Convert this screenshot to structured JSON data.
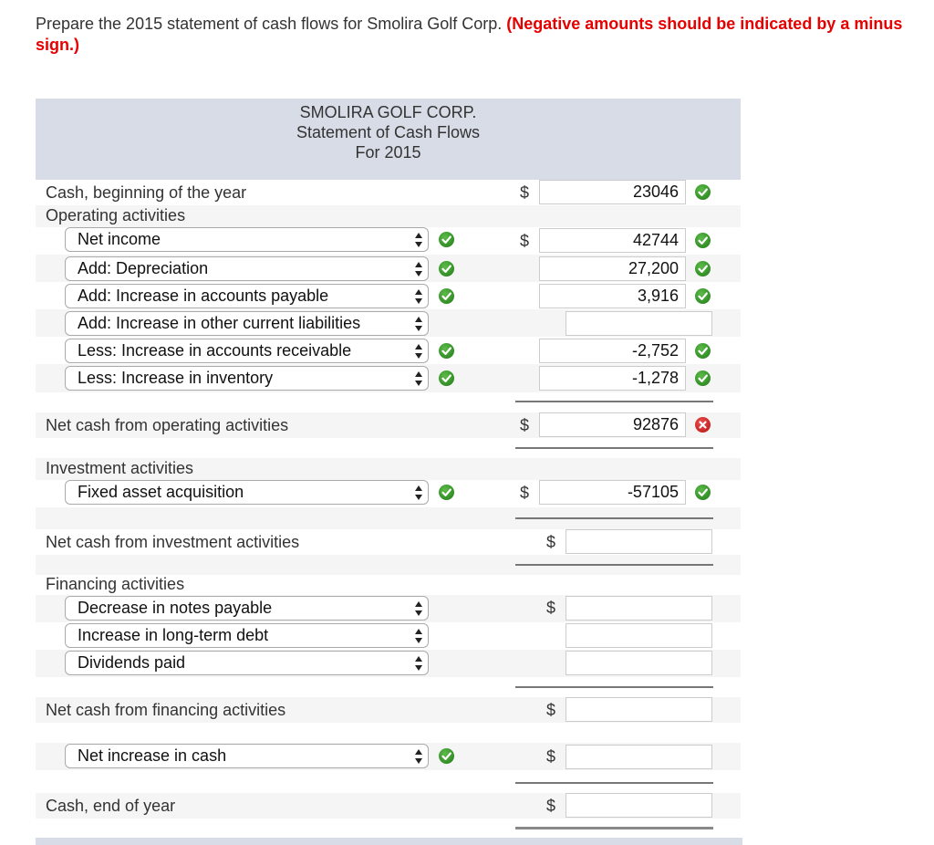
{
  "instructions": {
    "text": "Prepare the 2015 statement of cash flows for Smolira Golf Corp.",
    "note": "(Negative amounts should be indicated by a minus sign.)"
  },
  "header": {
    "company": "SMOLIRA GOLF CORP.",
    "statement": "Statement of Cash Flows",
    "period": "For 2015"
  },
  "currency_symbol": "$",
  "cash_beginning": {
    "label": "Cash, beginning of the year",
    "value": "23046",
    "status": "correct"
  },
  "operating": {
    "heading": "Operating activities",
    "items": [
      {
        "select": "Net income",
        "select_status": "correct",
        "value": "42744",
        "value_status": "correct",
        "show_dollar": true
      },
      {
        "select": "Add: Depreciation",
        "select_status": "correct",
        "value": "27,200",
        "value_status": "correct",
        "show_dollar": false
      },
      {
        "select": "Add: Increase in accounts payable",
        "select_status": "correct",
        "value": "3,916",
        "value_status": "correct",
        "show_dollar": false
      },
      {
        "select": "Add: Increase in other current liabilities",
        "select_status": "none",
        "value": "",
        "value_status": "none",
        "show_dollar": false
      },
      {
        "select": "Less: Increase in accounts receivable",
        "select_status": "correct",
        "value": "-2,752",
        "value_status": "correct",
        "show_dollar": false
      },
      {
        "select": "Less: Increase in inventory",
        "select_status": "correct",
        "value": "-1,278",
        "value_status": "correct",
        "show_dollar": false
      }
    ],
    "total_label": "Net cash from operating activities",
    "total_value": "92876",
    "total_status": "incorrect"
  },
  "investment": {
    "heading": "Investment activities",
    "items": [
      {
        "select": "Fixed asset acquisition",
        "select_status": "correct",
        "value": "-57105",
        "value_status": "correct"
      }
    ],
    "total_label": "Net cash from investment activities",
    "total_value": ""
  },
  "financing": {
    "heading": "Financing activities",
    "items": [
      {
        "select": "Decrease in notes payable",
        "value": ""
      },
      {
        "select": "Increase in long-term debt",
        "value": ""
      },
      {
        "select": "Dividends paid",
        "value": ""
      }
    ],
    "total_label": "Net cash from financing activities",
    "total_value": ""
  },
  "net_increase": {
    "select": "Net increase in cash",
    "select_status": "correct",
    "value": ""
  },
  "cash_end": {
    "label": "Cash, end of year",
    "value": ""
  },
  "colors": {
    "correct": "#2e8b22",
    "incorrect": "#d41515",
    "header_bg": "#d7dce6",
    "note": "#e60000"
  }
}
